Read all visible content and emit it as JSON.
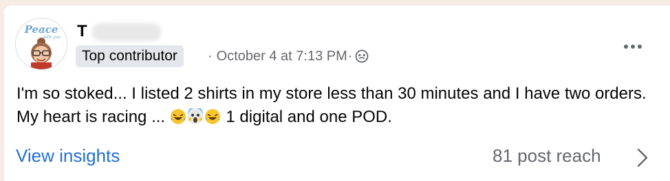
{
  "post": {
    "author_name": "T",
    "badge": "Top contributor",
    "timestamp": "October 4 at 7:13 PM",
    "separator": "·",
    "audience_icon": "globe-icon",
    "more_icon": "more-options-icon",
    "text_part1": "I'm so stoked... I listed 2 shirts in my store less than 30 minutes  and I have two orders. My heart is racing ... ",
    "emojis": [
      "rolling-on-floor-laughing-emoji",
      "screaming-in-fear-emoji",
      "rolling-on-floor-laughing-emoji"
    ],
    "text_part2": " 1 digital and one POD."
  },
  "footer": {
    "insights_label": "View insights",
    "reach_label": "81 post reach",
    "chevron_icon": "chevron-right-icon"
  },
  "avatar": {
    "text": "Peace",
    "subtext": "with you"
  },
  "colors": {
    "link": "#216fdb",
    "secondary_text": "#65676b",
    "badge_bg": "#e4e6eb"
  }
}
